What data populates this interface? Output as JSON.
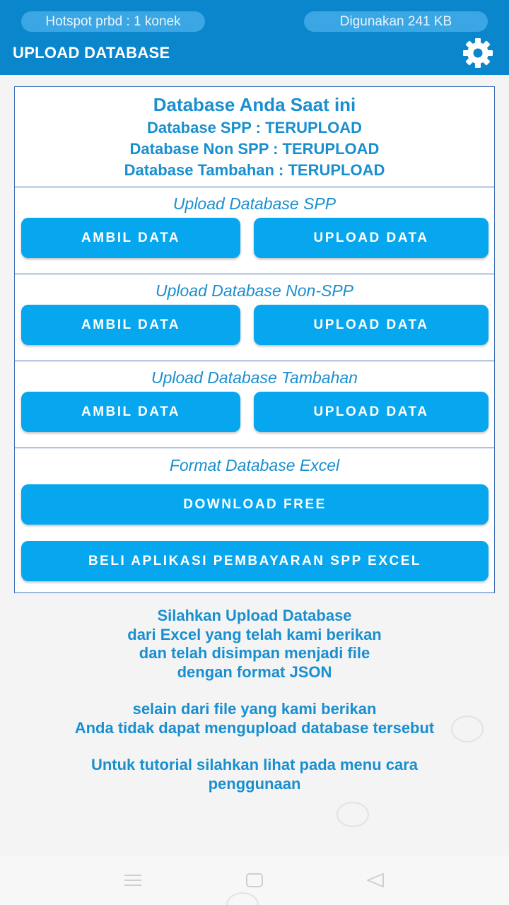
{
  "statusbar": {
    "hotspot": "Hotspot prbd : 1 konek",
    "usage": "Digunakan 241 KB"
  },
  "appbar": {
    "title": "UPLOAD DATABASE",
    "settings_icon": "gear-icon"
  },
  "status_box": {
    "heading": "Database Anda Saat ini",
    "lines": [
      "Database SPP : TERUPLOAD",
      "Database Non SPP : TERUPLOAD",
      "Database Tambahan : TERUPLOAD"
    ]
  },
  "sections": [
    {
      "title": "Upload Database SPP",
      "fetch_label": "AMBIL DATA",
      "upload_label": "UPLOAD DATA"
    },
    {
      "title": "Upload Database Non-SPP",
      "fetch_label": "AMBIL DATA",
      "upload_label": "UPLOAD DATA"
    },
    {
      "title": "Upload Database Tambahan",
      "fetch_label": "AMBIL DATA",
      "upload_label": "UPLOAD DATA"
    }
  ],
  "format_section": {
    "title": "Format Database Excel",
    "download_label": "DOWNLOAD FREE",
    "buy_label": "BELI APLIKASI PEMBAYARAN SPP EXCEL"
  },
  "info": {
    "paragraph1": [
      "Silahkan Upload Database",
      "dari Excel yang telah kami berikan",
      "dan telah disimpan menjadi file",
      "dengan format JSON"
    ],
    "paragraph2": [
      "selain dari file yang kami berikan",
      "Anda tidak dapat mengupload database tersebut"
    ],
    "paragraph3": [
      "Untuk tutorial silahkan lihat pada menu cara",
      "penggunaan"
    ]
  },
  "navbar": {
    "icons": [
      "menu-icon",
      "home-square-icon",
      "back-triangle-icon"
    ]
  },
  "colors": {
    "appbar": "#0a86cc",
    "button": "#06a7ef",
    "text_accent": "#1a8fcf",
    "border": "#3f6fb6"
  }
}
